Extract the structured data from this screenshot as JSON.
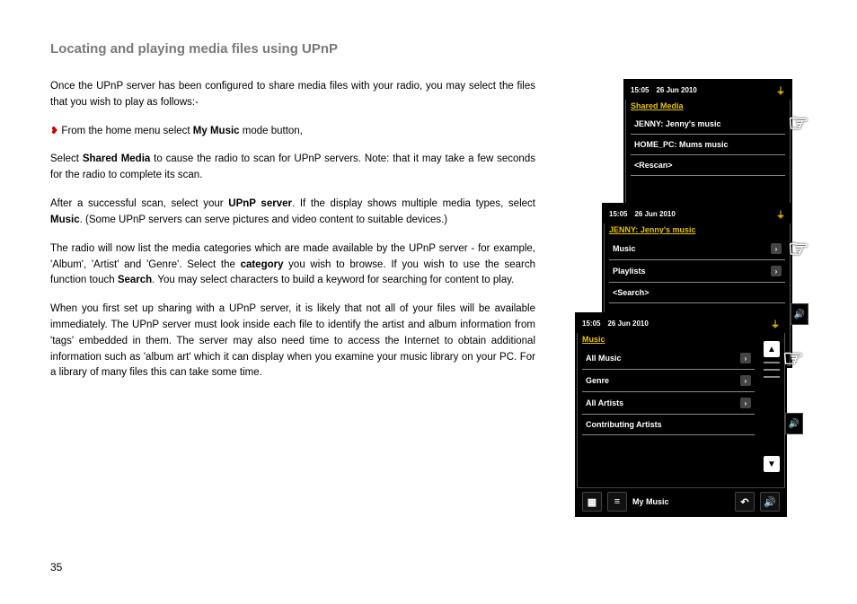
{
  "page": {
    "title": "Locating and playing media files using UPnP",
    "page_number": "35"
  },
  "para": {
    "p1": "Once the UPnP server has been configured to share media files with your radio, you may select the files that you wish to play as follows:-",
    "p2_pre": "From the home menu select ",
    "p2_bold": "My Music",
    "p2_post": " mode button,",
    "p3_pre": "Select ",
    "p3_bold": "Shared Media",
    "p3_post": " to cause the radio to scan for UPnP servers. Note: that it may take a few seconds for the radio to complete its scan.",
    "p4_pre": "After a successful scan, select your ",
    "p4_bold": "UPnP server",
    "p4_mid": ". If the display shows multiple media types, select ",
    "p4_bold2": "Music",
    "p4_post": ". (Some UPnP servers can serve pictures and video content to suitable devices.)",
    "p5_pre": "The radio will now list the media categories which are made available by the UPnP server - for example, 'Album', 'Artist' and 'Genre'. Select the ",
    "p5_bold": "category",
    "p5_mid": " you wish to browse. If you wish to use the search function touch ",
    "p5_bold2": "Search",
    "p5_post": ". You may select characters to build a keyword for searching for content to play.",
    "p6": "When you first set up sharing with a UPnP server, it is likely that not all of your files will be available immediately. The UPnP server must look inside each file to identify the artist and album information from 'tags' embedded in them. The server may also need time to access the Internet to obtain additional information such as 'album art' which it can display when you examine your music library on your PC. For a library of many files this can take some time."
  },
  "status": {
    "time": "15:05",
    "date": "26 Jun 2010"
  },
  "screen1": {
    "heading": "Shared Media",
    "items": [
      "JENNY: Jenny's music",
      "HOME_PC: Mums music",
      "<Rescan>"
    ]
  },
  "screen2": {
    "heading": "JENNY: Jenny's music",
    "items": [
      "Music",
      "Playlists",
      "<Search>"
    ]
  },
  "screen3": {
    "heading": "Music",
    "items": [
      "All Music",
      "Genre",
      "All Artists",
      "Contributing Artists"
    ],
    "breadcrumb": "My Music"
  }
}
